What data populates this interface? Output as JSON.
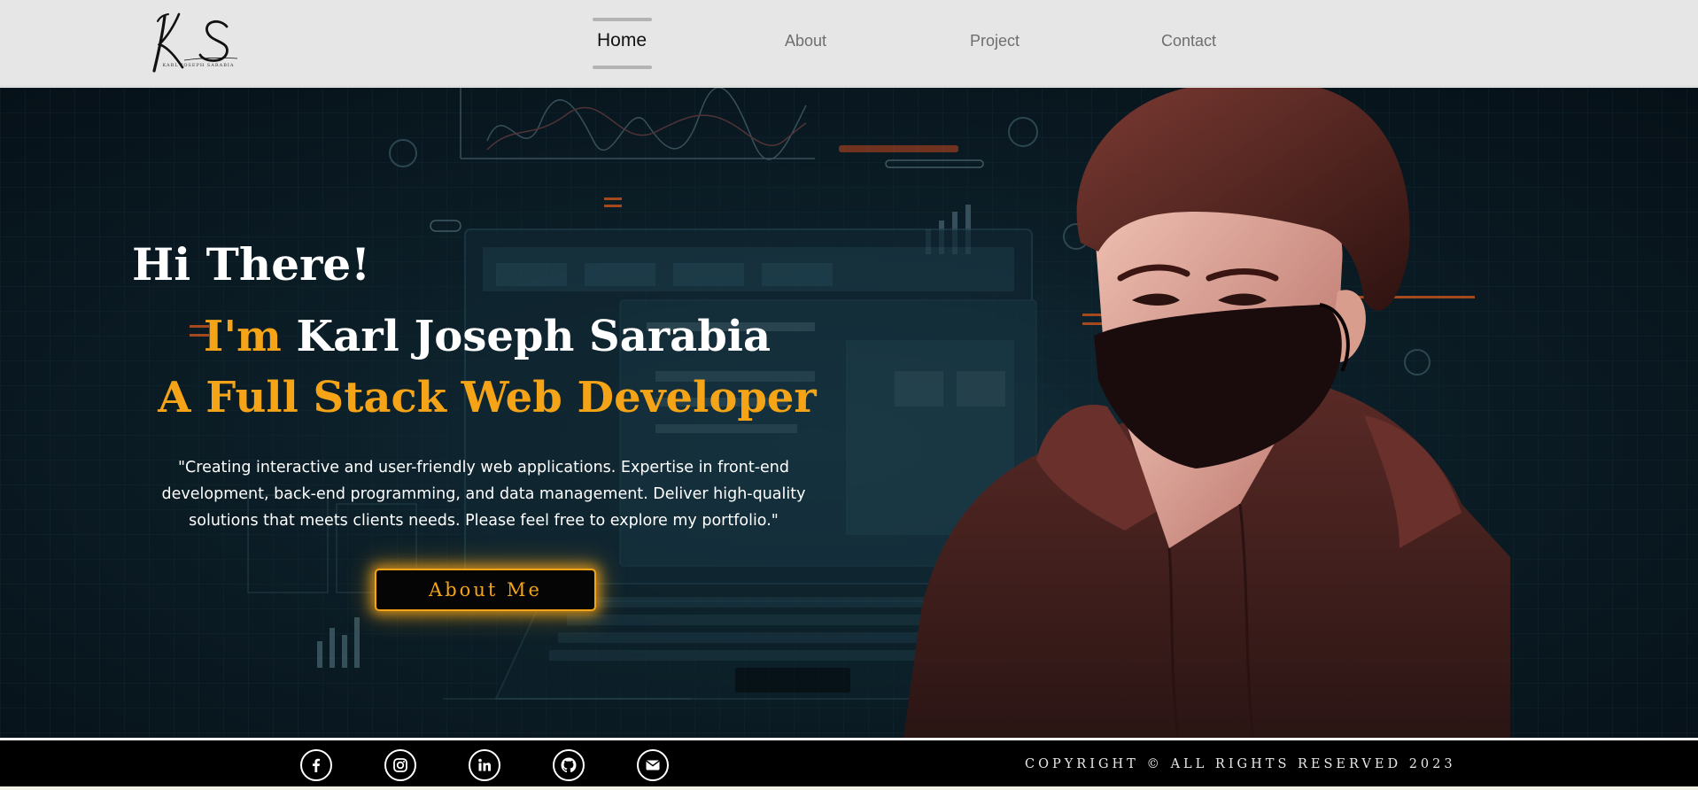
{
  "header": {
    "logo_initials": "KS",
    "logo_caption": "KARL JOSEPH SARABIA",
    "nav": [
      {
        "label": "Home",
        "active": true
      },
      {
        "label": "About",
        "active": false
      },
      {
        "label": "Project",
        "active": false
      },
      {
        "label": "Contact",
        "active": false
      }
    ]
  },
  "hero": {
    "greeting": "Hi There!",
    "intro_prefix": "I'm",
    "name": "Karl Joseph Sarabia",
    "role": "A Full Stack Web Developer",
    "tagline": "\"Creating interactive and user-friendly web applications. Expertise in front-end development, back-end programming, and data management. Deliver high-quality solutions that meets clients needs. Please feel free to explore my portfolio.\"",
    "cta_label": "About Me"
  },
  "footer": {
    "social_icons": [
      "facebook-icon",
      "instagram-icon",
      "linkedin-icon",
      "github-icon",
      "email-icon"
    ],
    "copyright": "COPYRIGHT © ALL RIGHTS RESERVED 2023"
  },
  "colors": {
    "accent": "#f5a418",
    "header_bg": "#e6e6e6",
    "hero_bg": "#0b1d26",
    "footer_bg": "#000000"
  }
}
